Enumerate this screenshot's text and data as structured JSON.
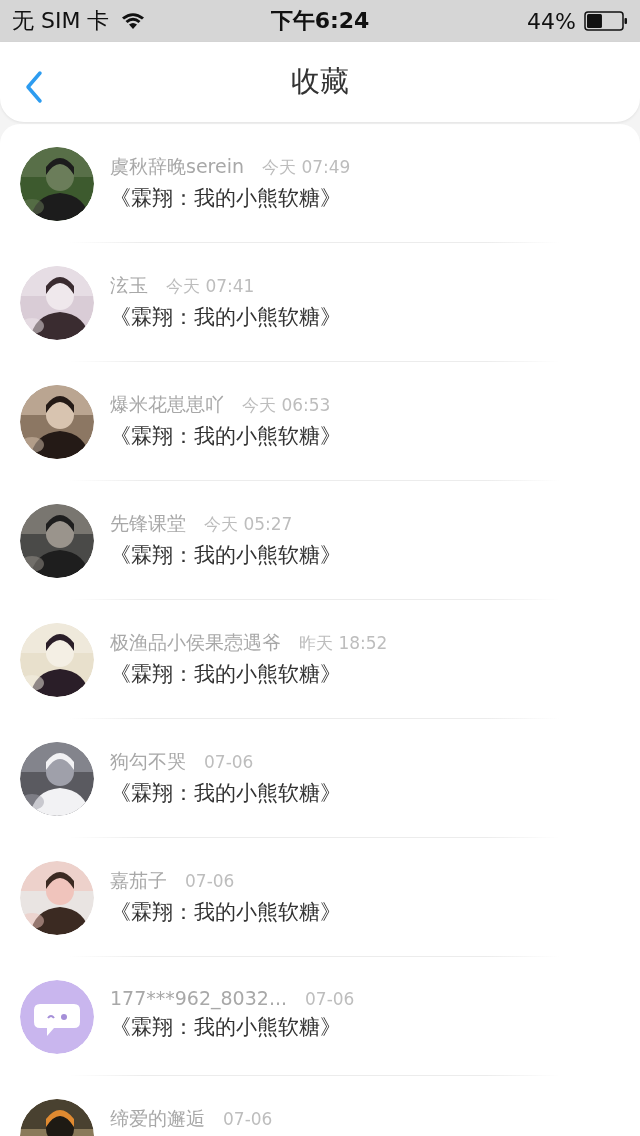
{
  "status_bar": {
    "carrier": "无 SIM 卡",
    "time": "下午6:24",
    "battery": "44%"
  },
  "nav": {
    "title": "收藏"
  },
  "items": [
    {
      "name": "虞秋辞晚serein",
      "time": "今天 07:49",
      "title": "《霖翔：我的小熊软糖》"
    },
    {
      "name": "泫玉",
      "time": "今天 07:41",
      "title": "《霖翔：我的小熊软糖》"
    },
    {
      "name": "爆米花崽崽吖",
      "time": "今天 06:53",
      "title": "《霖翔：我的小熊软糖》"
    },
    {
      "name": "先锋课堂",
      "time": "今天 05:27",
      "title": "《霖翔：我的小熊软糖》"
    },
    {
      "name": "极渔品小侯果悫遇爷",
      "time": "昨天 18:52",
      "title": "《霖翔：我的小熊软糖》"
    },
    {
      "name": "狗勾不哭",
      "time": "07-06",
      "title": "《霖翔：我的小熊软糖》"
    },
    {
      "name": "嘉茄子",
      "time": "07-06",
      "title": "《霖翔：我的小熊软糖》"
    },
    {
      "avatar": {
        "kind": "icon"
      },
      "name": "177***962_8032...",
      "time": "07-06",
      "title": "《霖翔：我的小熊软糖》"
    },
    {
      "name": "缔爱的邂逅",
      "time": "07-06"
    }
  ]
}
